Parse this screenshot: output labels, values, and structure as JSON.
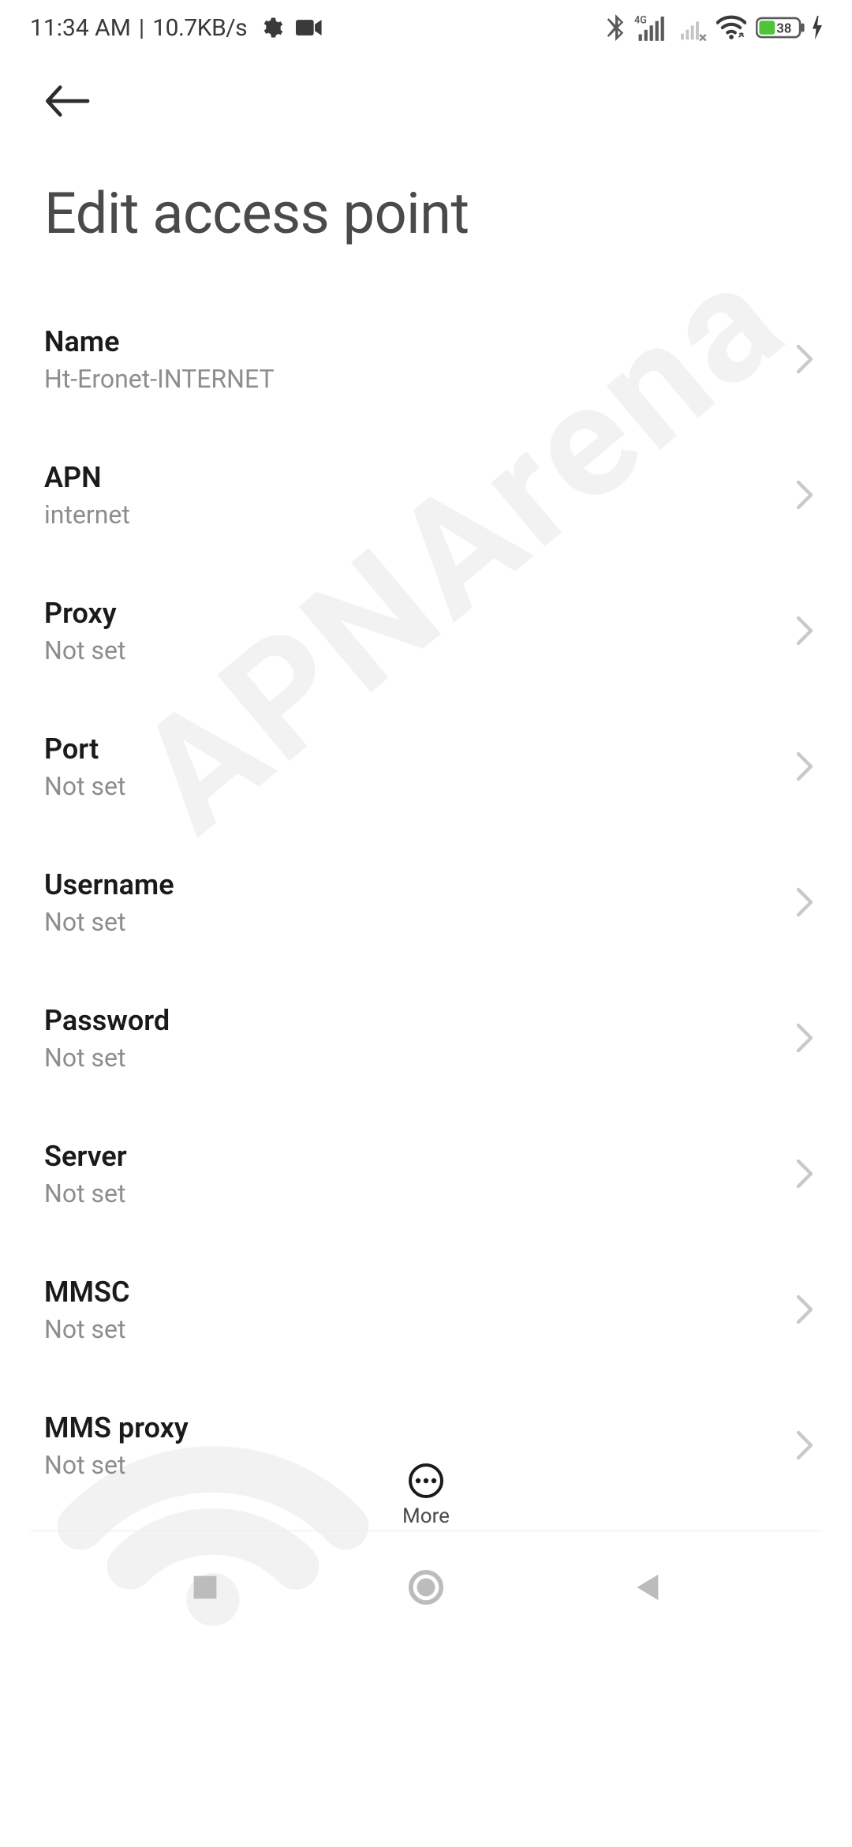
{
  "status": {
    "time": "11:34 AM",
    "sep": "|",
    "net_speed": "10.7KB/s",
    "battery_pct": "38"
  },
  "header": {
    "title": "Edit access point"
  },
  "fields": [
    {
      "label": "Name",
      "value": "Ht-Eronet-INTERNET"
    },
    {
      "label": "APN",
      "value": "internet"
    },
    {
      "label": "Proxy",
      "value": "Not set"
    },
    {
      "label": "Port",
      "value": "Not set"
    },
    {
      "label": "Username",
      "value": "Not set"
    },
    {
      "label": "Password",
      "value": "Not set"
    },
    {
      "label": "Server",
      "value": "Not set"
    },
    {
      "label": "MMSC",
      "value": "Not set"
    },
    {
      "label": "MMS proxy",
      "value": "Not set"
    }
  ],
  "bottom": {
    "more_label": "More"
  },
  "watermark": "APNArena"
}
